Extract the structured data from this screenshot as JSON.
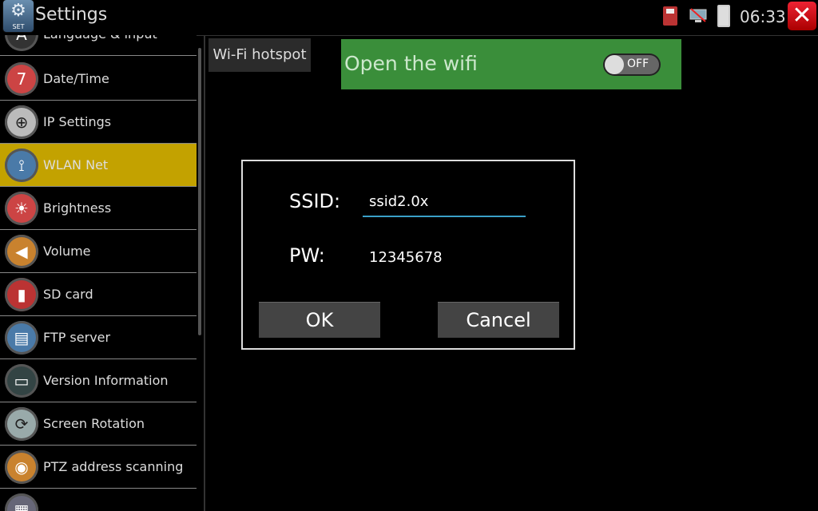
{
  "header": {
    "app_icon_text": "SET",
    "title": "Settings",
    "clock": "06:33",
    "icons": [
      "sd-card-icon",
      "network-disconnected-icon",
      "battery-icon",
      "close-icon"
    ]
  },
  "sidebar": {
    "items": [
      {
        "label": "Language & input",
        "icon": "language-icon",
        "active": false
      },
      {
        "label": "Date/Time",
        "icon": "calendar-clock-icon",
        "active": false
      },
      {
        "label": "IP Settings",
        "icon": "globe-icon",
        "active": false
      },
      {
        "label": "WLAN Net",
        "icon": "antenna-icon",
        "active": true
      },
      {
        "label": "Brightness",
        "icon": "brightness-icon",
        "active": false
      },
      {
        "label": "Volume",
        "icon": "speaker-icon",
        "active": false
      },
      {
        "label": "SD card",
        "icon": "sd-card-icon",
        "active": false
      },
      {
        "label": "FTP server",
        "icon": "ftp-server-icon",
        "active": false
      },
      {
        "label": "Version Information",
        "icon": "monitor-icon",
        "active": false
      },
      {
        "label": "Screen Rotation",
        "icon": "rotation-icon",
        "active": false
      },
      {
        "label": "PTZ address scanning",
        "icon": "ptz-camera-icon",
        "active": false
      },
      {
        "label": "",
        "icon": "partial-item-icon",
        "active": false
      }
    ]
  },
  "main": {
    "hotspot_button": "Wi-Fi hotspot",
    "wifi_label": "Open the wifi",
    "wifi_toggle": "OFF"
  },
  "dialog": {
    "ssid_label": "SSID:",
    "ssid_value": "ssid2.0x",
    "pw_label": "PW:",
    "pw_value": "12345678",
    "ok_label": "OK",
    "cancel_label": "Cancel"
  },
  "colors": {
    "active_item": "#c3a200",
    "wifi_panel": "#3a8e3a",
    "close_button": "#cc1a22",
    "input_underline": "#3aa0c8"
  }
}
